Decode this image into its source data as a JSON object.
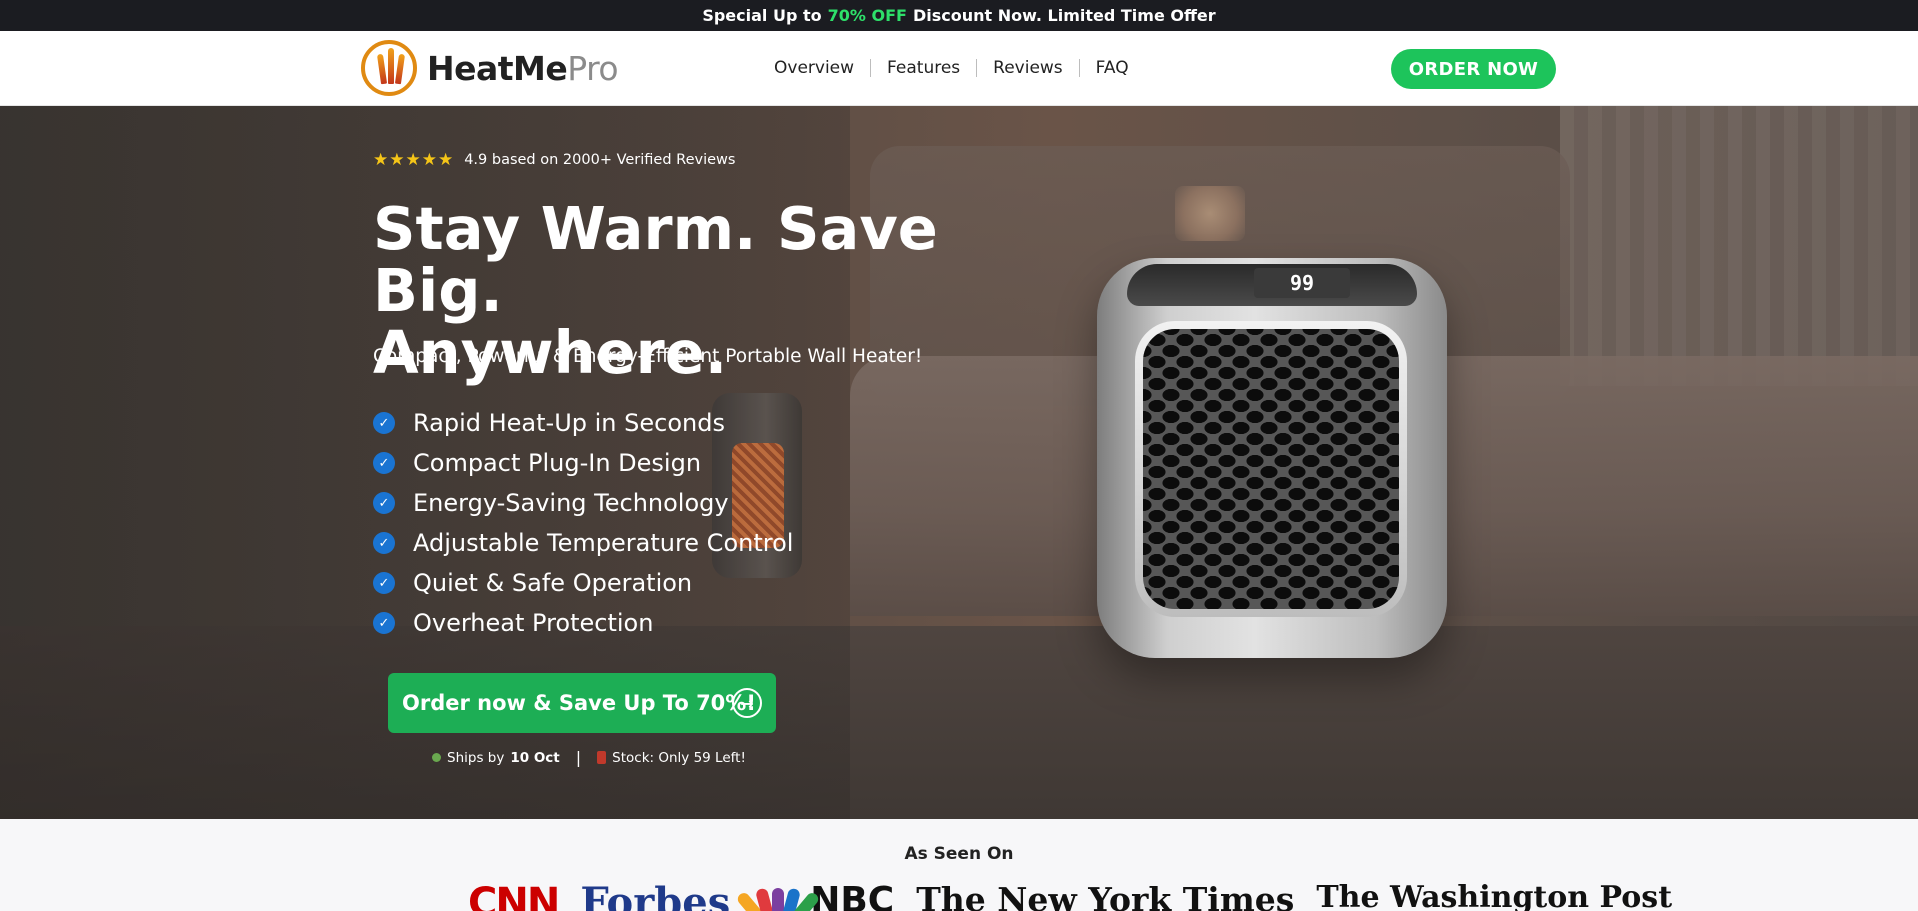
{
  "promo": {
    "prefix": "Special Up to",
    "highlight": "70% OFF",
    "suffix": "Discount Now. Limited Time Offer"
  },
  "brand": {
    "name_main": "HeatMe",
    "name_suffix": "Pro"
  },
  "nav": {
    "items": [
      "Overview",
      "Features",
      "Reviews",
      "FAQ"
    ],
    "order_button": "ORDER NOW"
  },
  "hero": {
    "rating_stars": 5,
    "rating_text": "4.9 based on 2000+ Verified Reviews",
    "headline_line1": "Stay Warm. Save Big.",
    "headline_line2": "Anywhere.",
    "subheadline": "Compact, Powerful & Energy-Efficient Portable Wall Heater!",
    "features": [
      "Rapid Heat-Up in Seconds",
      "Compact Plug-In Design",
      "Energy-Saving Technology",
      "Adjustable Temperature Control",
      "Quiet & Safe Operation",
      "Overheat Protection"
    ],
    "cta_label": "Order now & Save Up To 70%!",
    "ships_prefix": "Ships by",
    "ships_date": "10 Oct",
    "stock_text": "Stock: Only 59 Left!",
    "heater_display": "99"
  },
  "as_seen_on": {
    "title": "As Seen On",
    "logos": [
      "CNN",
      "Forbes",
      "NBC",
      "The New York Times",
      "The Washington Post"
    ]
  },
  "colors": {
    "accent_green": "#1dc45b",
    "promo_highlight": "#2ee06a",
    "check_blue": "#1a74d2",
    "star_yellow": "#f5c518",
    "promo_bg": "#1b1c21"
  }
}
